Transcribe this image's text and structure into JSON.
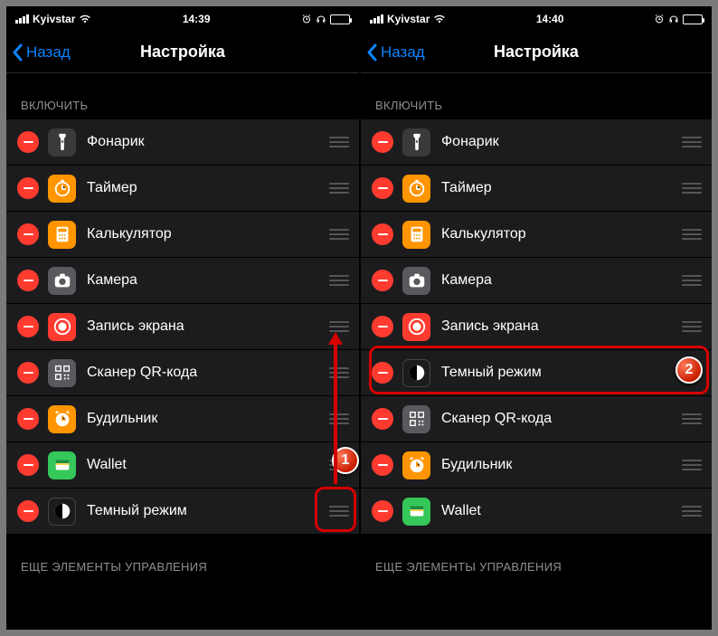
{
  "phones": [
    {
      "status": {
        "carrier": "Kyivstar",
        "time": "14:39"
      },
      "nav": {
        "back": "Назад",
        "title": "Настройка"
      },
      "section_include": "ВКЛЮЧИТЬ",
      "section_more": "ЕЩЕ ЭЛЕМЕНТЫ УПРАВЛЕНИЯ",
      "items": [
        {
          "label": "Фонарик",
          "icon": "flashlight",
          "bg": "bg-dark"
        },
        {
          "label": "Таймер",
          "icon": "timer",
          "bg": "bg-orange"
        },
        {
          "label": "Калькулятор",
          "icon": "calc",
          "bg": "bg-orange"
        },
        {
          "label": "Камера",
          "icon": "camera",
          "bg": "bg-gray"
        },
        {
          "label": "Запись экрана",
          "icon": "record",
          "bg": "bg-red-rec"
        },
        {
          "label": "Сканер QR-кода",
          "icon": "qr",
          "bg": "bg-gray"
        },
        {
          "label": "Будильник",
          "icon": "alarm",
          "bg": "bg-orange"
        },
        {
          "label": "Wallet",
          "icon": "wallet",
          "bg": "bg-green"
        },
        {
          "label": "Темный режим",
          "icon": "darkmode",
          "bg": "bg-black"
        }
      ]
    },
    {
      "status": {
        "carrier": "Kyivstar",
        "time": "14:40"
      },
      "nav": {
        "back": "Назад",
        "title": "Настройка"
      },
      "section_include": "ВКЛЮЧИТЬ",
      "section_more": "ЕЩЕ ЭЛЕМЕНТЫ УПРАВЛЕНИЯ",
      "items": [
        {
          "label": "Фонарик",
          "icon": "flashlight",
          "bg": "bg-dark"
        },
        {
          "label": "Таймер",
          "icon": "timer",
          "bg": "bg-orange"
        },
        {
          "label": "Калькулятор",
          "icon": "calc",
          "bg": "bg-orange"
        },
        {
          "label": "Камера",
          "icon": "camera",
          "bg": "bg-gray"
        },
        {
          "label": "Запись экрана",
          "icon": "record",
          "bg": "bg-red-rec"
        },
        {
          "label": "Темный режим",
          "icon": "darkmode",
          "bg": "bg-black"
        },
        {
          "label": "Сканер QR-кода",
          "icon": "qr",
          "bg": "bg-gray"
        },
        {
          "label": "Будильник",
          "icon": "alarm",
          "bg": "bg-orange"
        },
        {
          "label": "Wallet",
          "icon": "wallet",
          "bg": "bg-green"
        }
      ]
    }
  ],
  "callouts": {
    "one": "1",
    "two": "2"
  }
}
